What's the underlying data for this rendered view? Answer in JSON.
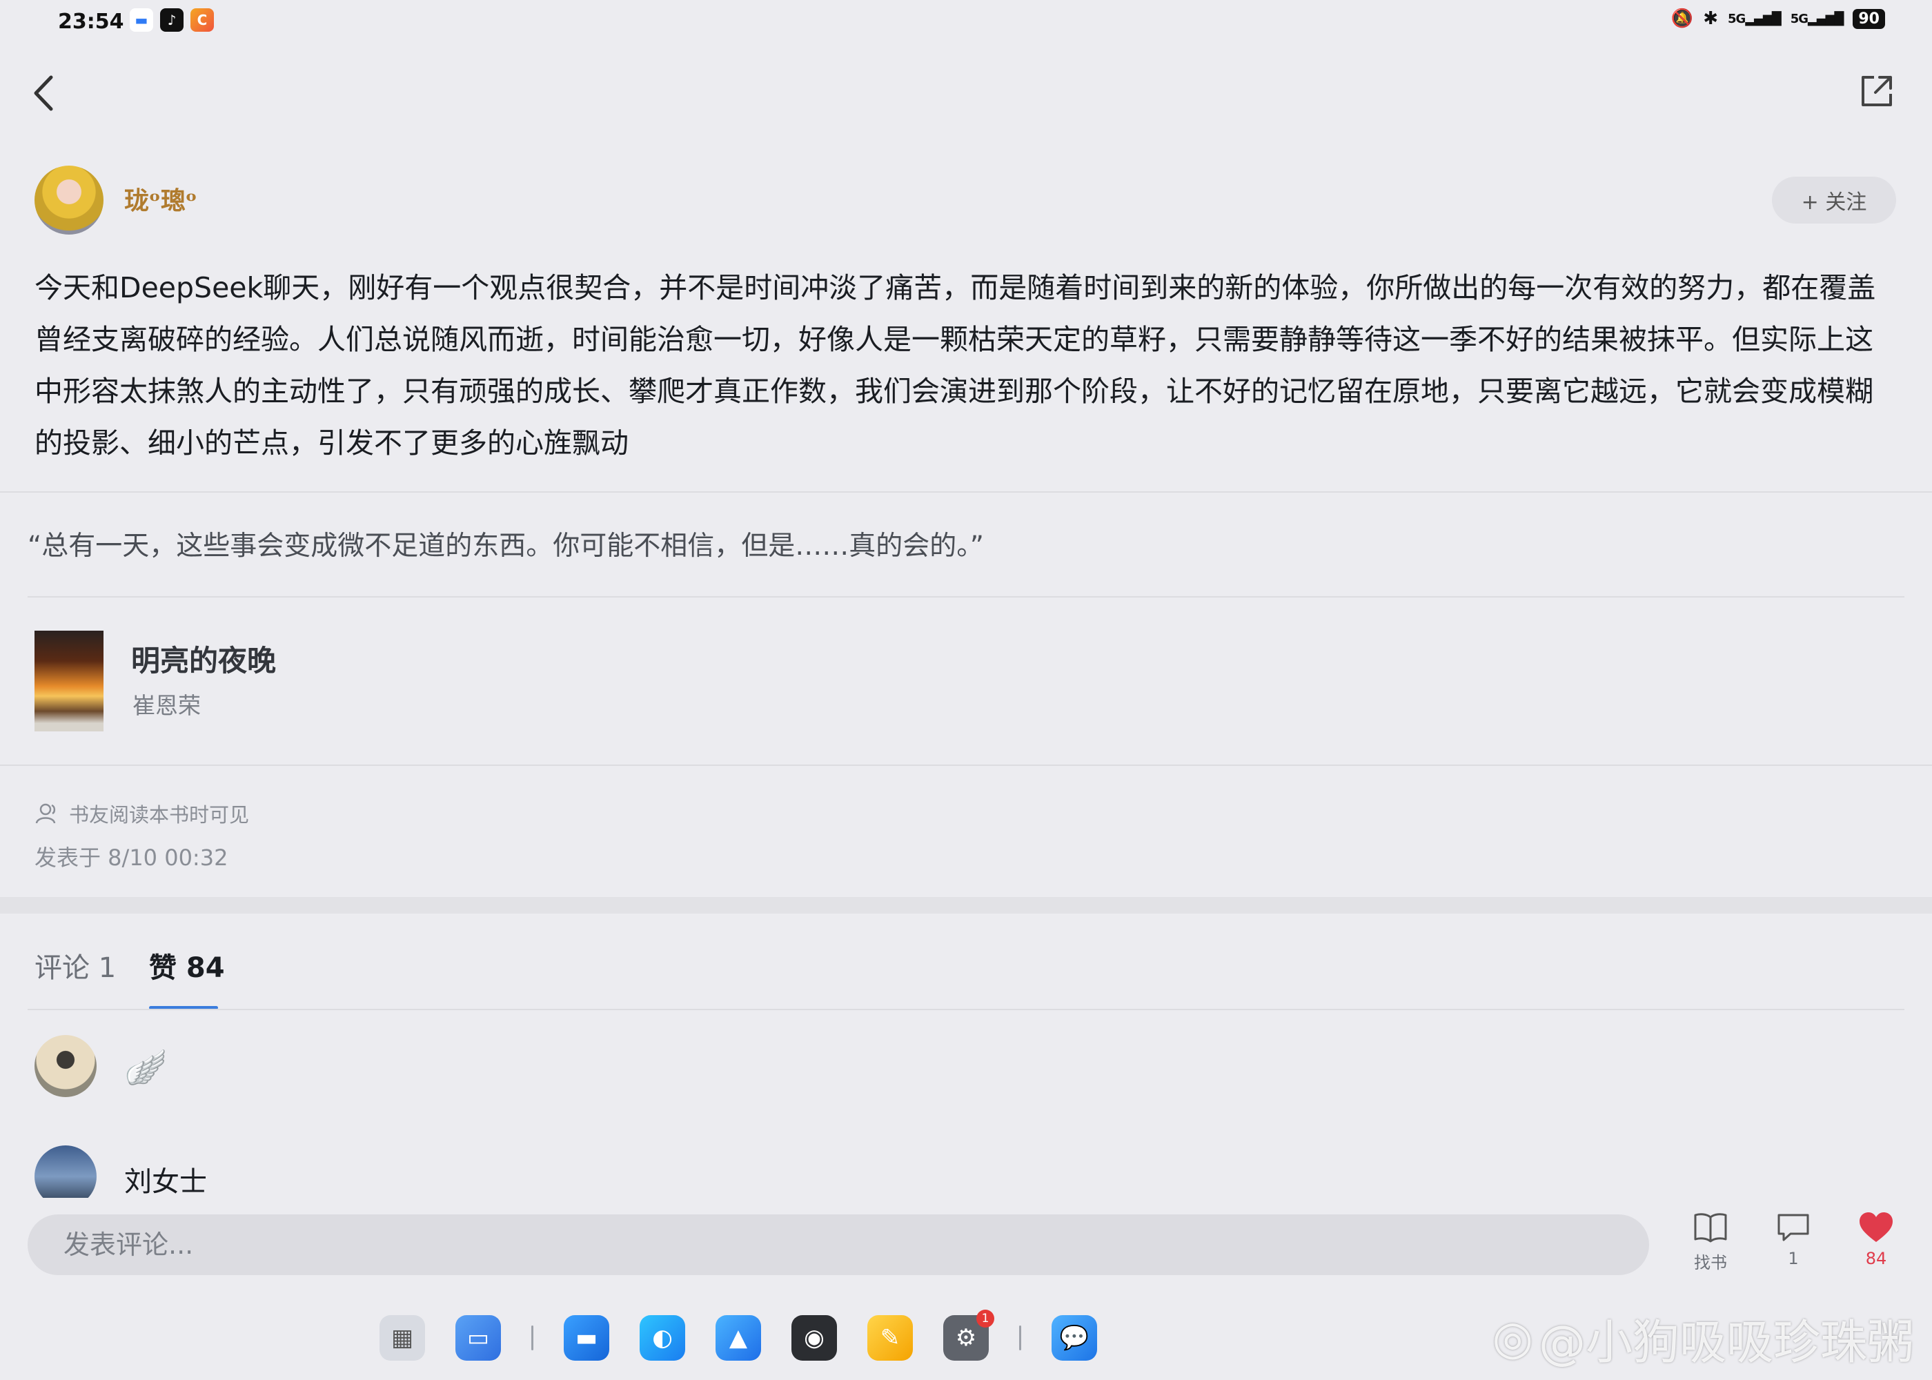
{
  "status_bar": {
    "time": "23:54",
    "signal_1": "5G",
    "signal_2": "5G",
    "battery": "90"
  },
  "author": {
    "name": "珑ᵒ璁ᵒ",
    "follow_label": "+ 关注"
  },
  "post": {
    "text": "今天和DeepSeek聊天，刚好有一个观点很契合，并不是时间冲淡了痛苦，而是随着时间到来的新的体验，你所做出的每一次有效的努力，都在覆盖曾经支离破碎的经验。人们总说随风而逝，时间能治愈一切，好像人是一颗枯荣天定的草籽，只需要静静等待这一季不好的结果被抹平。但实际上这中形容太抹煞人的主动性了，只有顽强的成长、攀爬才真正作数，我们会演进到那个阶段，让不好的记忆留在原地，只要离它越远，它就会变成模糊的投影、细小的芒点，引发不了更多的心旌飘动",
    "quote": "“总有一天，这些事会变成微不足道的东西。你可能不相信，但是……真的会的。”",
    "visibility": "书友阅读本书时可见",
    "posted_at": "发表于 8/10 00:32"
  },
  "book": {
    "title": "明亮的夜晚",
    "author": "崔恩荣"
  },
  "tabs": {
    "comments": "评论 1",
    "likes": "赞 84"
  },
  "likers": [
    {
      "name": ""
    },
    {
      "name": "刘女士"
    }
  ],
  "bottom_bar": {
    "comment_placeholder": "发表评论...",
    "find_book": "找书",
    "comment_count": "1",
    "like_count": "84"
  },
  "dock": {
    "settings_badge": "1"
  },
  "watermark": "@小狗吸吸珍珠粥",
  "colors": {
    "accent": "#3b7ddd",
    "like_red": "#e03b4b",
    "background": "#ececf0"
  }
}
